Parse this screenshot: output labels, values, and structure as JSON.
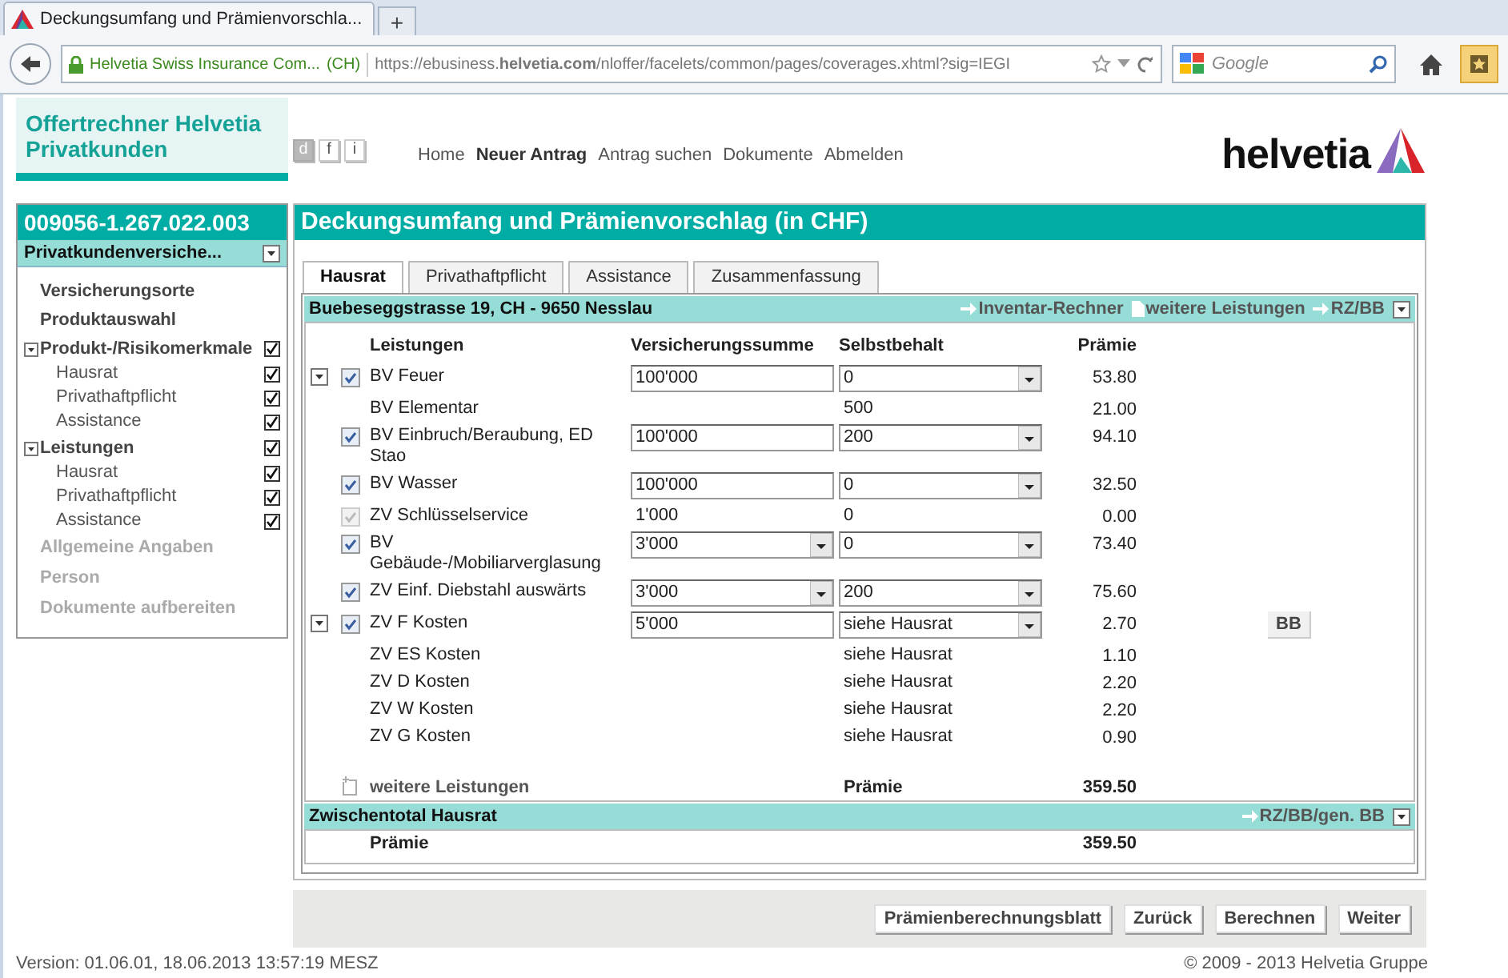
{
  "browser": {
    "tab_title": "Deckungsumfang und Prämienvorschla...",
    "new_tab": "+",
    "site_identity": "Helvetia Swiss Insurance Com...",
    "site_country": "(CH)",
    "url": "https://ebusiness.**helvetia.com**/nloffer/facelets/common/pages/coverages.xhtml?sig=IEGI",
    "search_placeholder": "Google"
  },
  "header": {
    "app_title": "Offertrechner Helvetia Privatkunden",
    "languages": [
      {
        "label": "d",
        "selected": true
      },
      {
        "label": "f",
        "selected": false
      },
      {
        "label": "i",
        "selected": false
      }
    ],
    "nav": [
      {
        "label": "Home",
        "selected": false
      },
      {
        "label": "Neuer Antrag",
        "selected": true
      },
      {
        "label": "Antrag suchen",
        "selected": false
      },
      {
        "label": "Dokumente",
        "selected": false
      },
      {
        "label": "Abmelden",
        "selected": false
      }
    ],
    "logo": "helvetia"
  },
  "sidebar": {
    "case_number": "009056-1.267.022.003",
    "product": "Privatkundenversiche...",
    "items": [
      {
        "kind": "step",
        "label": "Versicherungsorte"
      },
      {
        "kind": "step",
        "label": "Produktauswahl"
      },
      {
        "kind": "group",
        "label": "Produkt-/Risikomerkmale",
        "expanded": true,
        "checked": true,
        "children": [
          {
            "label": "Hausrat",
            "checked": true
          },
          {
            "label": "Privathaftpflicht",
            "checked": true
          },
          {
            "label": "Assistance",
            "checked": true
          }
        ]
      },
      {
        "kind": "group",
        "label": "Leistungen",
        "expanded": true,
        "checked": true,
        "children": [
          {
            "label": "Hausrat",
            "checked": true
          },
          {
            "label": "Privathaftpflicht",
            "checked": true
          },
          {
            "label": "Assistance",
            "checked": true
          }
        ]
      },
      {
        "kind": "inactive",
        "label": "Allgemeine Angaben"
      },
      {
        "kind": "inactive",
        "label": "Person"
      },
      {
        "kind": "inactive",
        "label": "Dokumente aufbereiten"
      }
    ]
  },
  "main": {
    "title": "Deckungsumfang und Prämienvorschlag (in CHF)",
    "tabs": [
      {
        "label": "Hausrat",
        "selected": true
      },
      {
        "label": "Privathaftpflicht",
        "selected": false
      },
      {
        "label": "Assistance",
        "selected": false
      },
      {
        "label": "Zusammenfassung",
        "selected": false
      }
    ],
    "section": {
      "address": "Buebeseggstrasse 19, CH - 9650 Nesslau",
      "links": [
        {
          "label": "Inventar-Rechner",
          "kind": "arrow"
        },
        {
          "label": "weitere Leistungen",
          "kind": "page"
        },
        {
          "label": "RZ/BB",
          "kind": "arrow"
        }
      ],
      "columns": [
        "Leistungen",
        "Versicherungssumme",
        "Selbstbehalt",
        "Prämie"
      ],
      "rows": [
        {
          "name": "BV Feuer",
          "expander": {
            "expanded": true
          },
          "checkbox": {
            "checked": true,
            "disabled": false
          },
          "sum": {
            "kind": "input",
            "value": "100'000"
          },
          "deductible": {
            "kind": "select",
            "value": "0"
          },
          "premium": "53.80"
        },
        {
          "name": "BV Elementar",
          "deductible": {
            "kind": "text",
            "value": "500"
          },
          "premium": "21.00"
        },
        {
          "name": "BV Einbruch/Beraubung, ED Stao",
          "checkbox": {
            "checked": true,
            "disabled": false
          },
          "sum": {
            "kind": "input",
            "value": "100'000"
          },
          "deductible": {
            "kind": "select",
            "value": "200"
          },
          "premium": "94.10"
        },
        {
          "name": "BV Wasser",
          "checkbox": {
            "checked": true,
            "disabled": false
          },
          "sum": {
            "kind": "input",
            "value": "100'000"
          },
          "deductible": {
            "kind": "select",
            "value": "0"
          },
          "premium": "32.50"
        },
        {
          "name": "ZV Schlüsselservice",
          "checkbox": {
            "checked": true,
            "disabled": true
          },
          "sum": {
            "kind": "text",
            "value": "1'000"
          },
          "deductible": {
            "kind": "text",
            "value": "0"
          },
          "premium": "0.00"
        },
        {
          "name": "BV Gebäude-/Mobiliarverglasung",
          "checkbox": {
            "checked": true,
            "disabled": false
          },
          "sum": {
            "kind": "select",
            "value": "3'000"
          },
          "deductible": {
            "kind": "select",
            "value": "0"
          },
          "premium": "73.40"
        },
        {
          "name": "ZV Einf. Diebstahl auswärts",
          "checkbox": {
            "checked": true,
            "disabled": false
          },
          "sum": {
            "kind": "select",
            "value": "3'000"
          },
          "deductible": {
            "kind": "select",
            "value": "200"
          },
          "premium": "75.60"
        },
        {
          "name": "ZV F Kosten",
          "expander": {
            "expanded": true
          },
          "checkbox": {
            "checked": true,
            "disabled": false
          },
          "sum": {
            "kind": "input",
            "value": "5'000"
          },
          "deductible": {
            "kind": "select",
            "value": "siehe Hausrat"
          },
          "premium": "2.70",
          "button": "BB"
        },
        {
          "name": "ZV ES Kosten",
          "deductible": {
            "kind": "text",
            "value": "siehe Hausrat"
          },
          "premium": "1.10"
        },
        {
          "name": "ZV D Kosten",
          "deductible": {
            "kind": "text",
            "value": "siehe Hausrat"
          },
          "premium": "2.20"
        },
        {
          "name": "ZV W Kosten",
          "deductible": {
            "kind": "text",
            "value": "siehe Hausrat"
          },
          "premium": "2.20"
        },
        {
          "name": "ZV G Kosten",
          "deductible": {
            "kind": "text",
            "value": "siehe Hausrat"
          },
          "premium": "0.90"
        }
      ],
      "more_link": "weitere Leistungen",
      "total_label": "Prämie",
      "total": "359.50"
    },
    "subtotal": {
      "title": "Zwischentotal Hausrat",
      "link": "RZ/BB/gen. BB",
      "label": "Prämie",
      "value": "359.50"
    },
    "buttons": [
      "Prämienberechnungsblatt",
      "Zurück",
      "Berechnen",
      "Weiter"
    ]
  },
  "footer": {
    "version": "Version: 01.06.01, 18.06.2013 13:57:19 MESZ",
    "copyright": "© 2009 - 2013 Helvetia Gruppe"
  }
}
